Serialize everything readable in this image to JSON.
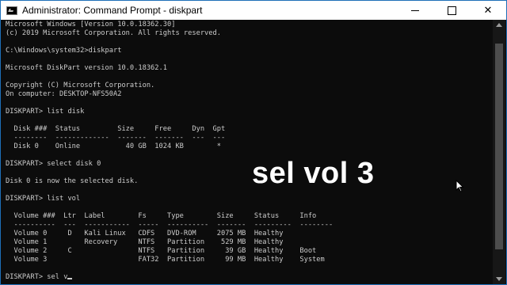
{
  "window": {
    "title": "Administrator: Command Prompt - diskpart",
    "border_color": "#1e6fb8"
  },
  "titlebar_buttons": {
    "close_glyph": "✕"
  },
  "console": {
    "text_color": "#cccccc",
    "background": "#0c0c0c",
    "lines": [
      "Microsoft Windows [Version 10.0.18362.30]",
      "(c) 2019 Microsoft Corporation. All rights reserved.",
      "",
      "C:\\Windows\\system32>diskpart",
      "",
      "Microsoft DiskPart version 10.0.18362.1",
      "",
      "Copyright (C) Microsoft Corporation.",
      "On computer: DESKTOP-NFS50A2",
      "",
      "DISKPART> list disk",
      "",
      "  Disk ###  Status         Size     Free     Dyn  Gpt",
      "  --------  -------------  -------  -------  ---  ---",
      "  Disk 0    Online           40 GB  1024 KB        *",
      "",
      "DISKPART> select disk 0",
      "",
      "Disk 0 is now the selected disk.",
      "",
      "DISKPART> list vol",
      "",
      "  Volume ###  Ltr  Label        Fs     Type        Size     Status     Info",
      "  ----------  ---  -----------  -----  ----------  -------  ---------  --------",
      "  Volume 0     D   Kali Linux   CDFS   DVD-ROM     2075 MB  Healthy",
      "  Volume 1         Recovery     NTFS   Partition    529 MB  Healthy",
      "  Volume 2     C                NTFS   Partition     39 GB  Healthy    Boot",
      "  Volume 3                      FAT32  Partition     99 MB  Healthy    System",
      "",
      "DISKPART> sel v"
    ]
  },
  "overlay": {
    "caption": "sel vol 3"
  },
  "icons": {
    "app": "cmd-icon",
    "minimize": "minimize-icon",
    "maximize": "maximize-icon",
    "close": "close-icon",
    "pointer": "mouse-pointer-icon"
  }
}
